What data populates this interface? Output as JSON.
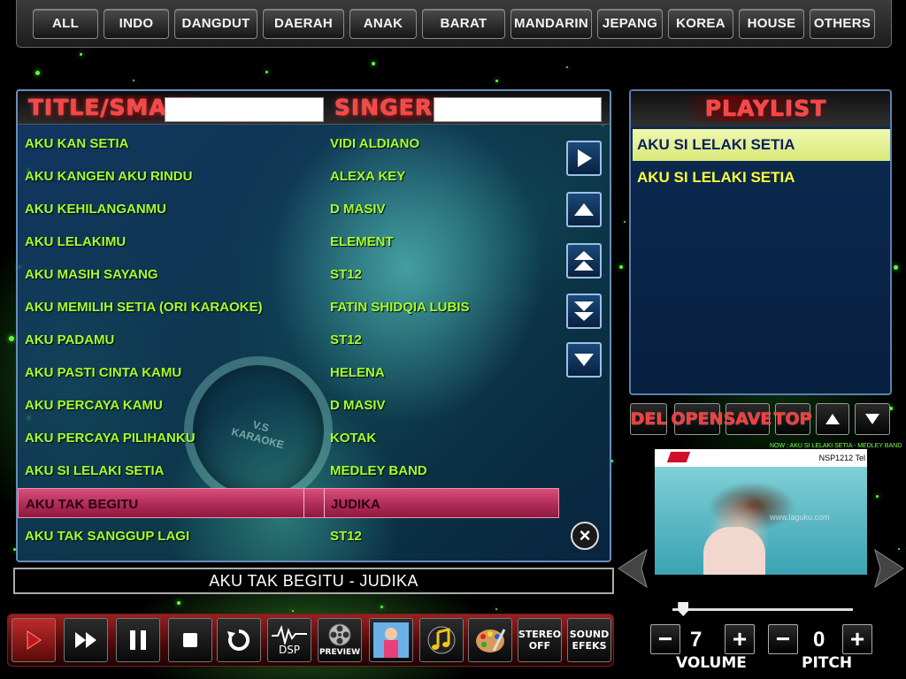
{
  "categories": [
    "ALL",
    "INDO",
    "DANGDUT",
    "DAERAH",
    "ANAK",
    "BARAT",
    "MANDARIN",
    "JEPANG",
    "KOREA",
    "HOUSE",
    "OTHERS"
  ],
  "song_list": {
    "title_header": "TITLE/SMART",
    "singer_header": "SINGERS",
    "title_search_value": "",
    "singer_search_value": "",
    "watermark_text": "V.S KARAOKE",
    "rows": [
      {
        "title": "AKU KAN SETIA",
        "singer": "VIDI ALDIANO"
      },
      {
        "title": "AKU KANGEN AKU RINDU",
        "singer": "ALEXA KEY"
      },
      {
        "title": "AKU KEHILANGANMU",
        "singer": "D MASIV"
      },
      {
        "title": "AKU LELAKIMU",
        "singer": "ELEMENT"
      },
      {
        "title": "AKU MASIH SAYANG",
        "singer": "ST12"
      },
      {
        "title": "AKU MEMILIH SETIA (ORI KARAOKE)",
        "singer": "FATIN SHIDQIA LUBIS"
      },
      {
        "title": "AKU PADAMU",
        "singer": "ST12"
      },
      {
        "title": "AKU PASTI CINTA KAMU",
        "singer": "HELENA"
      },
      {
        "title": "AKU PERCAYA KAMU",
        "singer": "D MASIV"
      },
      {
        "title": "AKU PERCAYA PILIHANKU",
        "singer": "KOTAK"
      },
      {
        "title": "AKU SI LELAKI SETIA",
        "singer": "MEDLEY BAND"
      },
      {
        "title": "AKU TAK BEGITU",
        "singer": "JUDIKA"
      },
      {
        "title": "AKU TAK SANGGUP LAGI",
        "singer": "ST12"
      }
    ],
    "selected_row": 11
  },
  "now_playing": "AKU TAK BEGITU - JUDIKA",
  "toolbar": {
    "dsp_label": "DSP",
    "preview_label": "PREVIEW",
    "stereo_label_1": "STEREO",
    "stereo_label_2": "OFF",
    "sound_label_1": "SOUND",
    "sound_label_2": "EFEKS"
  },
  "playlist": {
    "title": "PLAYLIST",
    "items": [
      "AKU SI LELAKI SETIA",
      "AKU SI LELAKI SETIA"
    ],
    "selected_index": 0,
    "controls": [
      "DEL",
      "OPEN",
      "SAVE",
      "TOP"
    ]
  },
  "preview_video": {
    "code": "NSP1212 Tel",
    "caption": "NOW : AKU SI LELAKI SETIA - MEDLEY BAND",
    "watermark": "www.laguku.com"
  },
  "volume": {
    "label": "VOLUME",
    "value": "7",
    "slider_fraction": 0.06
  },
  "pitch": {
    "label": "PITCH",
    "value": "0"
  },
  "colors": {
    "list_text": "#a6ff2a",
    "playlist_text": "#ffff33",
    "header_red": "#ff4444",
    "selection_pink": "#c03a66"
  }
}
